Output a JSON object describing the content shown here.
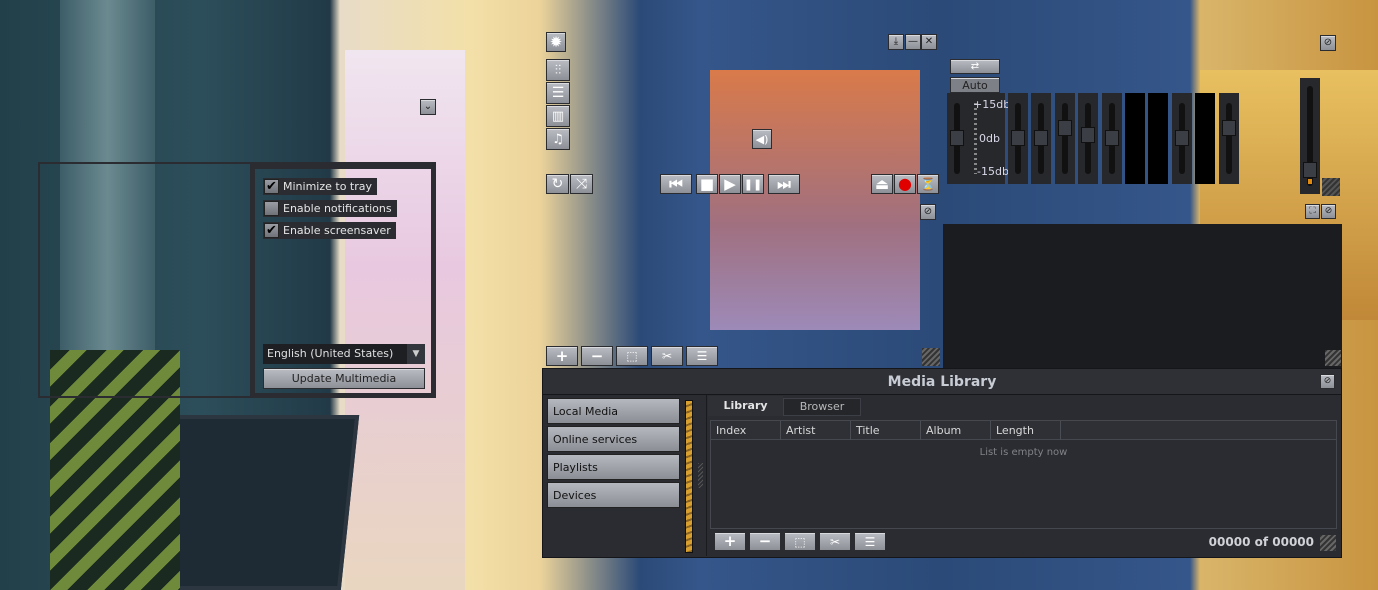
{
  "settings": {
    "checkboxes": [
      {
        "label": "Minimize to tray",
        "checked": true
      },
      {
        "label": "Enable notifications",
        "checked": false
      },
      {
        "label": "Enable screensaver",
        "checked": true
      }
    ],
    "language": "English (United States)",
    "update_button": "Update Multimedia"
  },
  "icons": {
    "check": "✔",
    "chevron": "⌄"
  },
  "player": {
    "window_buttons": [
      "⤓",
      "—",
      "✕"
    ],
    "side_buttons": [
      "gear-icon",
      "equalizer-icon",
      "playlist-icon",
      "video-icon",
      "music-library-icon"
    ],
    "transport": {
      "prev": "⏮",
      "stop": "■",
      "play": "▶",
      "pause": "❚❚",
      "next": "⏭",
      "eject": "⏏",
      "record": "●",
      "metronome": "⏳"
    },
    "volume_icon": "🔈"
  },
  "equalizer": {
    "auto_label": "Auto",
    "scale": [
      "+15db",
      "0db",
      "-15db"
    ],
    "bands": [
      0,
      0,
      0.15,
      0.05,
      0,
      null,
      null,
      0,
      null,
      0.15
    ],
    "preamp": 0,
    "balance": -0.85
  },
  "playlist_toolbar": [
    "+",
    "−",
    "⬚",
    "✂",
    "☰"
  ],
  "media_library": {
    "title": "Media Library",
    "nav": [
      "Local Media",
      "Online services",
      "Playlists",
      "Devices"
    ],
    "tabs": [
      {
        "label": "Library",
        "active": true
      },
      {
        "label": "Browser",
        "active": false
      }
    ],
    "columns": [
      "Index",
      "Artist",
      "Title",
      "Album",
      "Length"
    ],
    "empty_text": "List is empty now",
    "counter": "00000 of 00000"
  },
  "colors": {
    "panel": "#2a2c31",
    "record": "#e00000",
    "accent_stripe": "#c8962a"
  }
}
